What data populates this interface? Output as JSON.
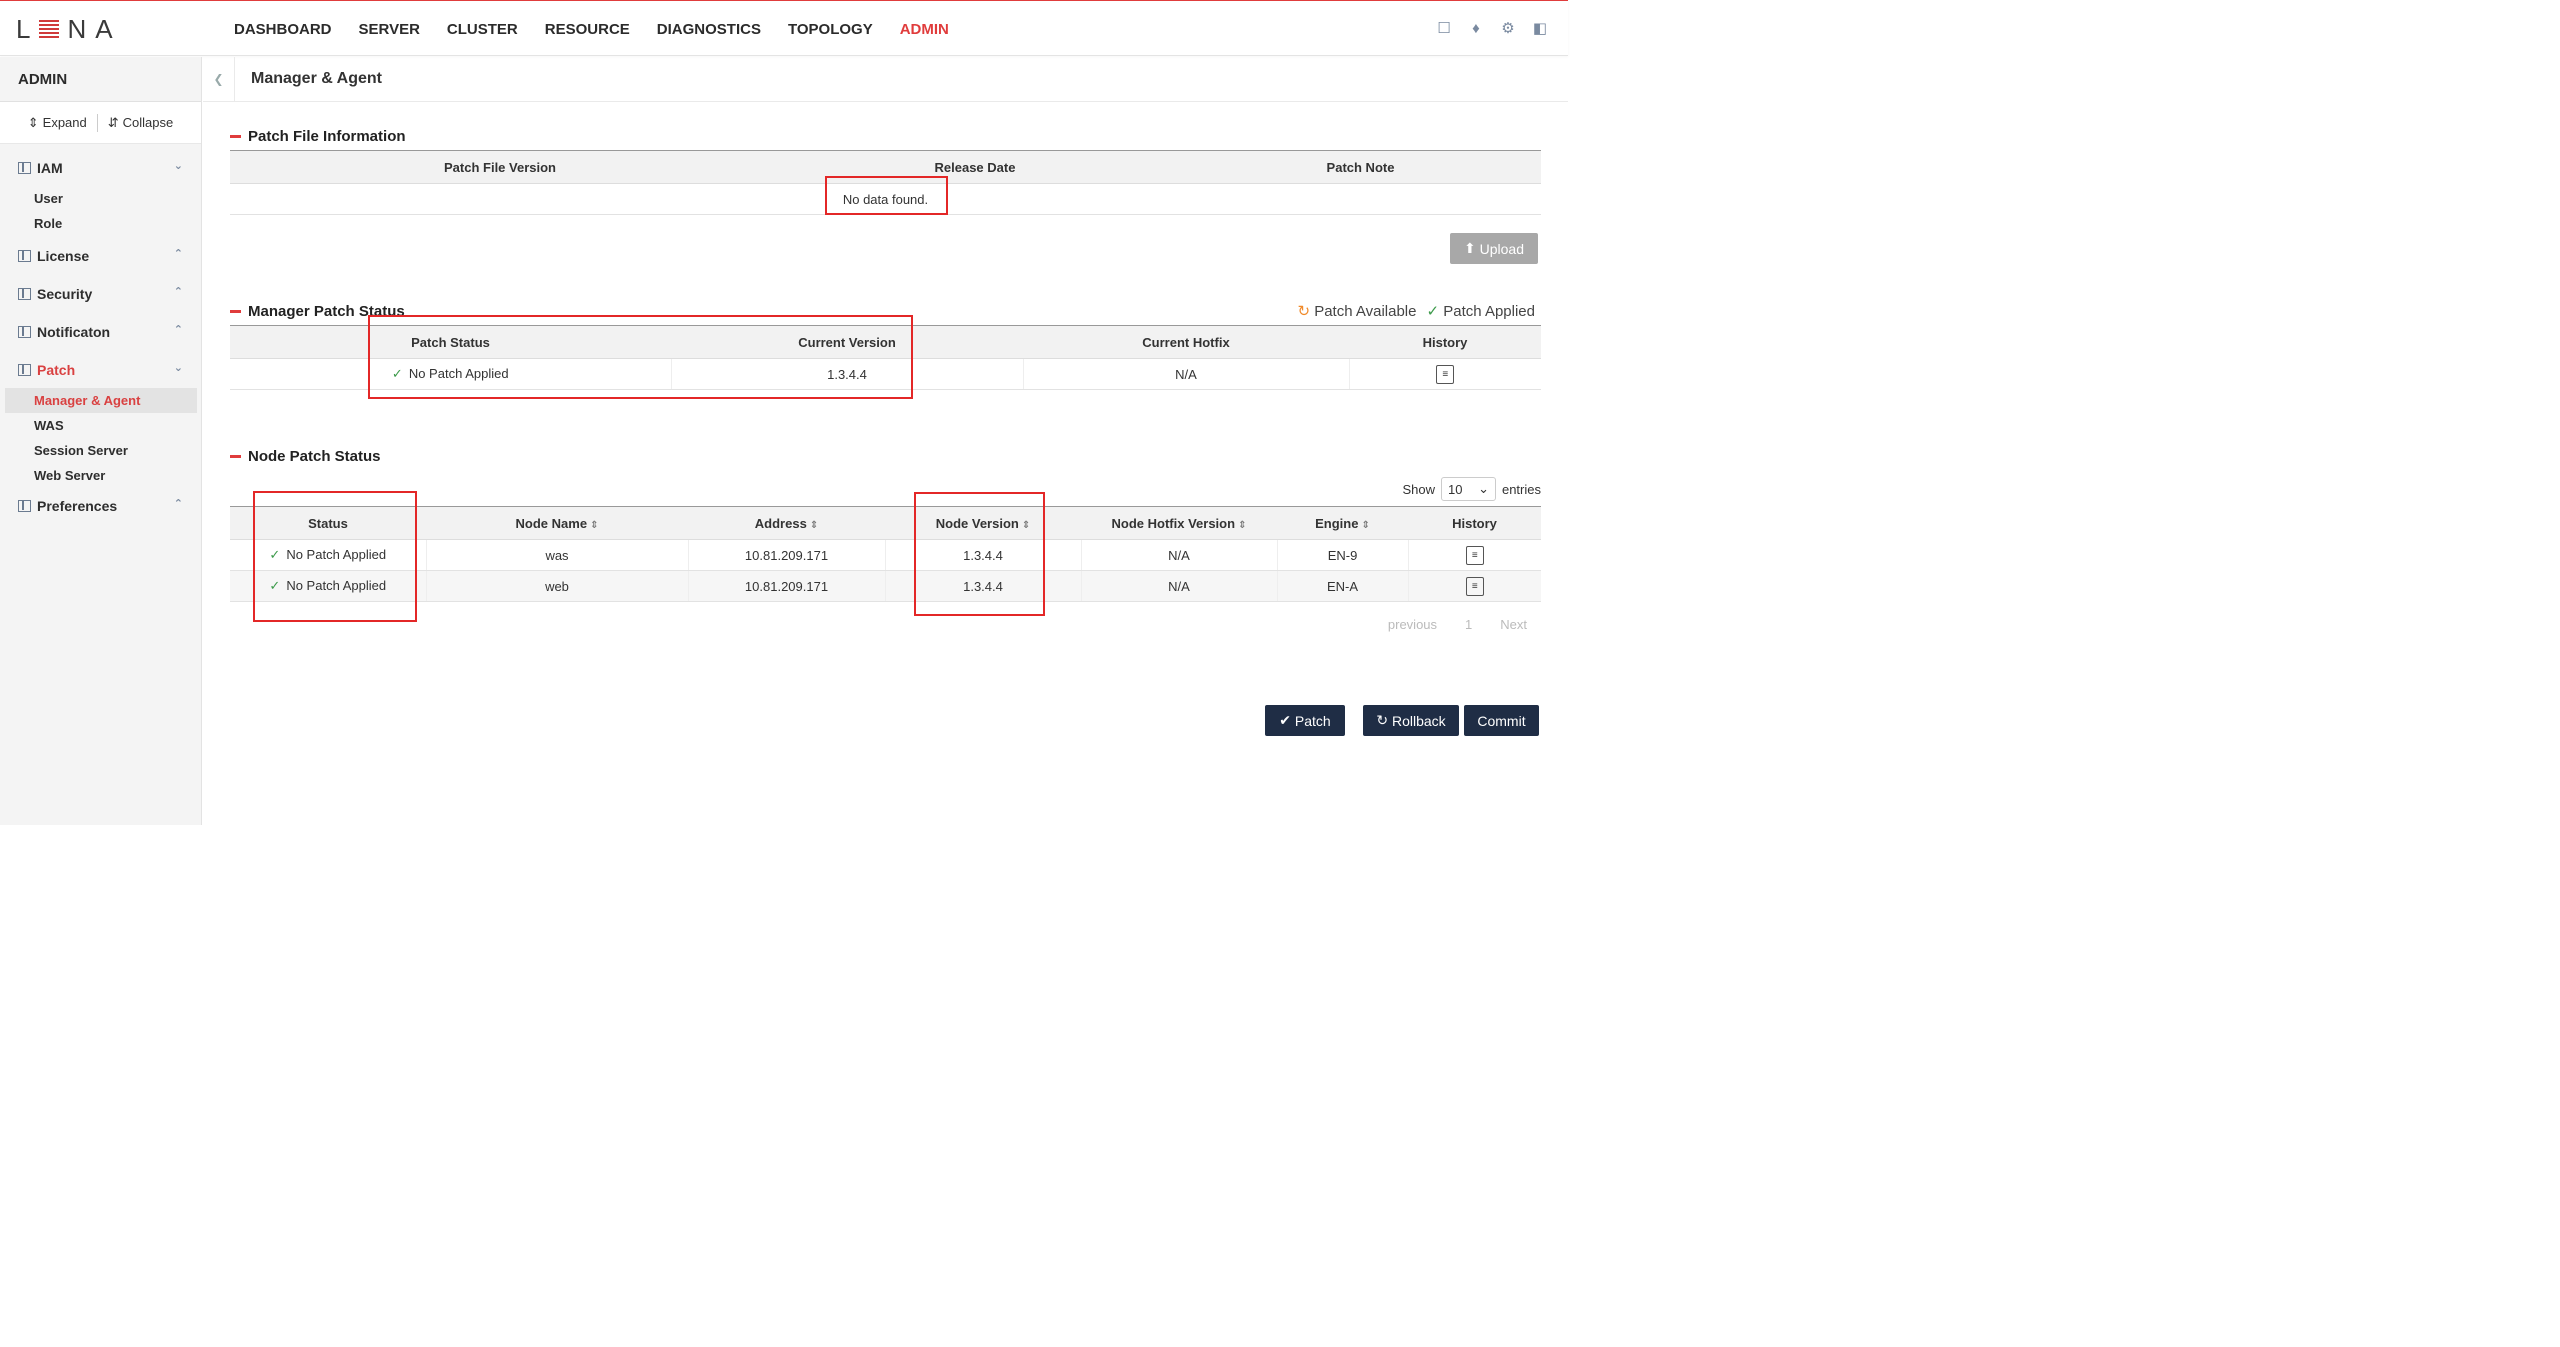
{
  "app": {
    "logo": "LENA"
  },
  "nav": [
    "DASHBOARD",
    "SERVER",
    "CLUSTER",
    "RESOURCE",
    "DIAGNOSTICS",
    "TOPOLOGY",
    "ADMIN"
  ],
  "nav_active": "ADMIN",
  "top_icons": [
    "help-icon",
    "bell-icon",
    "gear-icon",
    "logout-icon"
  ],
  "sidebar": {
    "title": "ADMIN",
    "expand_label": "Expand",
    "collapse_label": "Collapse",
    "groups": [
      {
        "label": "IAM",
        "items": [
          "User",
          "Role"
        ]
      },
      {
        "label": "License",
        "items": []
      },
      {
        "label": "Security",
        "items": []
      },
      {
        "label": "Notificaton",
        "items": []
      },
      {
        "label": "Patch",
        "items": [
          "Manager & Agent",
          "WAS",
          "Session Server",
          "Web Server"
        ]
      },
      {
        "label": "Preferences",
        "items": []
      }
    ],
    "active_item": "Manager & Agent"
  },
  "page": {
    "title": "Manager & Agent"
  },
  "patch_file": {
    "title": "Patch File Information",
    "columns": [
      "Patch File Version",
      "Release Date",
      "Patch Note"
    ],
    "empty": "No data found.",
    "upload_label": "Upload"
  },
  "manager": {
    "title": "Manager Patch Status",
    "legend_available": "Patch Available",
    "legend_applied": "Patch Applied",
    "columns": [
      "Patch Status",
      "Current Version",
      "Current Hotfix",
      "History"
    ],
    "row": {
      "status": "No Patch Applied",
      "version": "1.3.4.4",
      "hotfix": "N/A"
    }
  },
  "node": {
    "title": "Node Patch Status",
    "show_label": "Show",
    "entries_value": "10",
    "entries_label": "entries",
    "columns": [
      "Status",
      "Node Name",
      "Address",
      "Node Version",
      "Node Hotfix Version",
      "Engine",
      "History"
    ],
    "rows": [
      {
        "status": "No Patch Applied",
        "name": "was",
        "address": "10.81.209.171",
        "version": "1.3.4.4",
        "hotfix": "N/A",
        "engine": "EN-9"
      },
      {
        "status": "No Patch Applied",
        "name": "web",
        "address": "10.81.209.171",
        "version": "1.3.4.4",
        "hotfix": "N/A",
        "engine": "EN-A"
      }
    ],
    "pager": {
      "previous": "previous",
      "page": "1",
      "next": "Next"
    }
  },
  "actions": {
    "patch": "Patch",
    "rollback": "Rollback",
    "commit": "Commit"
  },
  "colors": {
    "accent": "#e03c3c",
    "button_dark": "#1f2d45",
    "annotation_box": "#e32727"
  }
}
